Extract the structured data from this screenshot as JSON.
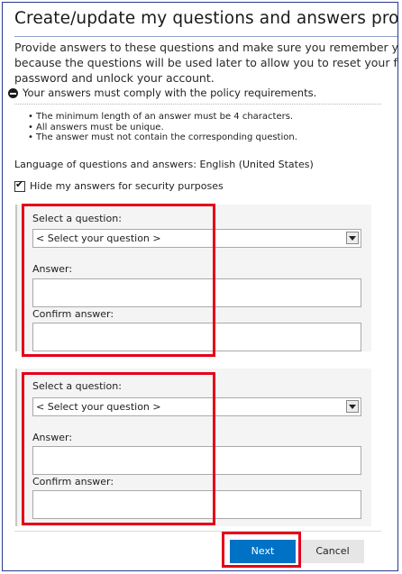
{
  "title": "Create/update my questions and answers profile",
  "intro": {
    "line1": "Provide answers to these questions and make sure you remember your answers",
    "line2": "because the questions will be used later to allow you to reset your forgotten",
    "line3": "password and unlock your account."
  },
  "policy": {
    "summary": "Your answers must comply with the policy requirements.",
    "rules": [
      "The minimum length of an answer must be 4 characters.",
      "All answers must be unique.",
      "The answer must not contain the corresponding question."
    ]
  },
  "language_text": "Language of questions and answers: English (United States)",
  "hide_answers": {
    "label": "Hide my answers for security purposes",
    "checked": true
  },
  "questions": [
    {
      "select_label": "Select a question:",
      "select_value": "< Select your question >",
      "answer_label": "Answer:",
      "answer_value": "",
      "confirm_label": "Confirm answer:",
      "confirm_value": ""
    },
    {
      "select_label": "Select a question:",
      "select_value": "< Select your question >",
      "answer_label": "Answer:",
      "answer_value": "",
      "confirm_label": "Confirm answer:",
      "confirm_value": ""
    }
  ],
  "buttons": {
    "next": "Next",
    "cancel": "Cancel"
  },
  "colors": {
    "highlight": "#e4001a",
    "primary_button": "#0072c6",
    "frame_border": "#2a3a8c"
  },
  "icons": {
    "policy": "minus-circle-icon",
    "dropdown": "chevron-down-icon"
  }
}
